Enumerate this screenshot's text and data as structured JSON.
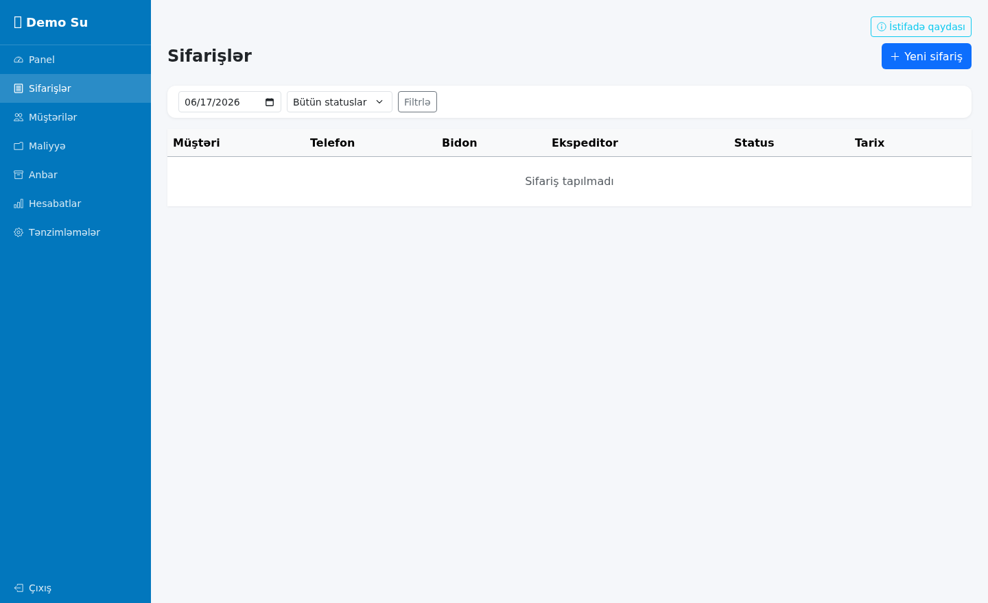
{
  "sidebar": {
    "brand": "Demo Su",
    "items": [
      {
        "label": "Panel",
        "selected": false
      },
      {
        "label": "Sifarişlər",
        "selected": true
      },
      {
        "label": "Müştərilər",
        "selected": false
      },
      {
        "label": "Maliyyə",
        "selected": false
      },
      {
        "label": "Anbar",
        "selected": false
      },
      {
        "label": "Hesabatlar",
        "selected": false
      },
      {
        "label": "Tənzimləmələr",
        "selected": false
      }
    ],
    "logout": {
      "label": "Çıxış"
    }
  },
  "header": {
    "help_button": {
      "label": "İstifadə qaydası"
    },
    "title": "Sifarişlər",
    "new_button": {
      "label": "Yeni sifariş"
    }
  },
  "filters": {
    "date": {
      "value": "06/17/2026"
    },
    "status": {
      "value": "Bütün statuslar"
    },
    "button": {
      "label": "Filtrlə"
    }
  },
  "table": {
    "columns": [
      "Müştəri",
      "Telefon",
      "Bidon",
      "Ekspeditor",
      "Status",
      "Tarix"
    ],
    "empty_message": "Sifariş tapılmadı"
  }
}
